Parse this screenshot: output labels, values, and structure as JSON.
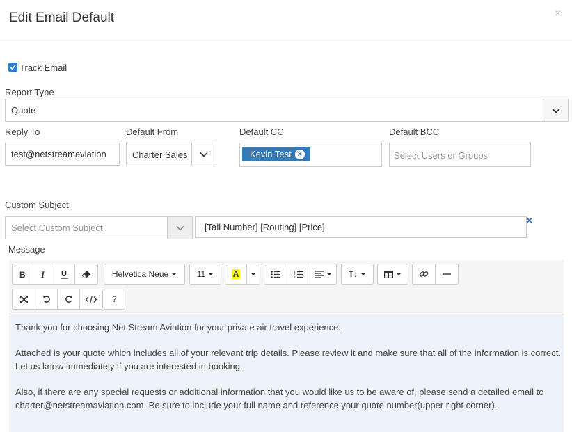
{
  "modal": {
    "title": "Edit Email Default",
    "close_label": "×"
  },
  "track_email": {
    "label": "Track Email",
    "checked": true
  },
  "report_type": {
    "label": "Report Type",
    "value": "Quote"
  },
  "reply_to": {
    "label": "Reply To",
    "value": "test@netstreamaviation"
  },
  "default_from": {
    "label": "Default From",
    "value": "Charter Sales"
  },
  "default_cc": {
    "label": "Default CC",
    "tags": [
      "Kevin Test"
    ],
    "remove_label": "×"
  },
  "default_bcc": {
    "label": "Default BCC",
    "placeholder": "Select Users or Groups"
  },
  "custom_subject": {
    "label": "Custom Subject",
    "placeholder": "Select Custom Subject",
    "value": "[Tail Number] [Routing] [Price]",
    "clear_label": "×"
  },
  "message": {
    "label": "Message",
    "toolbar": {
      "font_name": "Helvetica Neue",
      "font_size": "11",
      "color_label": "A",
      "line_height_label": "T↕",
      "help_label": "?"
    },
    "paragraphs": [
      "Thank you for choosing Net Stream Aviation for your private air travel experience.",
      "Attached is your quote which includes all of your relevant trip details. Please review it and make sure that all of the information is correct. Let us know immediately if you are interested in booking.",
      "Also, if there are any special requests or additional information that you would like us to be aware of, please send a detailed email to charter@netstreamaviation.com. Be sure to include your full name and reference your quote number(upper right corner)."
    ]
  },
  "colors": {
    "accent": "#337ab7",
    "highlight_yellow": "#ffff00",
    "editor_bg": "#eef3f9"
  }
}
